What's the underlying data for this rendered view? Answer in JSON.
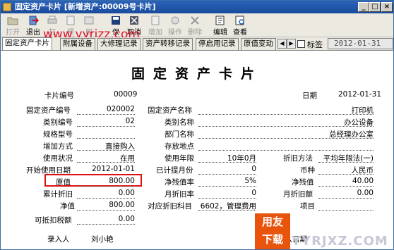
{
  "window": {
    "title": "固定资产卡片 [新增资产:00009号卡片]",
    "min_label": "_",
    "max_label": "□",
    "close_label": "×"
  },
  "watermark": "www.yyrjzz.com",
  "toolbar": [
    {
      "label": "打开",
      "icon": "open-icon",
      "enabled": false
    },
    {
      "label": "退出",
      "icon": "exit-icon",
      "enabled": true
    },
    {
      "label": "打",
      "icon": "print-icon",
      "enabled": false
    },
    {
      "label": "预",
      "icon": "preview-icon",
      "enabled": false
    },
    {
      "label": "刷",
      "icon": "refresh-icon",
      "enabled": false
    },
    {
      "label": "保",
      "icon": "save-icon",
      "enabled": true
    },
    {
      "label": "取消",
      "icon": "cancel-icon",
      "enabled": true
    },
    {
      "label": "增加",
      "icon": "add-icon",
      "enabled": false
    },
    {
      "label": "操作",
      "icon": "operate-icon",
      "enabled": false
    },
    {
      "label": "删除",
      "icon": "delete-icon",
      "enabled": false
    },
    {
      "label": "编辑",
      "icon": "edit-icon",
      "enabled": true
    },
    {
      "label": "查看",
      "icon": "view-icon",
      "enabled": true
    }
  ],
  "tabs": [
    {
      "label": "固定资产卡片",
      "active": true
    },
    {
      "label": "附属设备",
      "active": false
    },
    {
      "label": "大修理记录",
      "active": false
    },
    {
      "label": "资产转移记录",
      "active": false
    },
    {
      "label": "停启用记录",
      "active": false
    },
    {
      "label": "原值变动",
      "active": false
    }
  ],
  "tab_scroll": {
    "left": "◀",
    "right": "▶"
  },
  "tag_checkbox_label": "标签",
  "header_date": "2012-01-31",
  "card": {
    "title": "固定资产卡片",
    "card_no_label": "卡片编号",
    "card_no": "00009",
    "date_label": "日期",
    "date": "2012-01-31",
    "rows": {
      "asset_code_label": "固定资产编号",
      "asset_code": "020002",
      "asset_name_label": "固定资产名称",
      "asset_name": "打印机",
      "category_code_label": "类别编号",
      "category_code": "02",
      "category_name_label": "类别名称",
      "category_name": "办公设备",
      "spec_label": "规格型号",
      "spec": "",
      "dept_label": "部门名称",
      "dept": "总经理办公室",
      "add_method_label": "增加方式",
      "add_method": "直接购入",
      "location_label": "存放地点",
      "location": "",
      "usage_label": "使用状况",
      "usage": "在用",
      "life_label": "使用年限",
      "life": "10年0月",
      "dep_method_label": "折旧方法",
      "dep_method": "平均年限法(一)",
      "start_date_label": "开始使用日期",
      "start_date": "2012-01-01",
      "dep_months_label": "已计提月份",
      "dep_months": "0",
      "currency_label": "币种",
      "currency": "人民币",
      "orig_value_label": "原值",
      "orig_value": "800.00",
      "residual_rate_label": "净残值率",
      "residual_rate": "5%",
      "residual_label": "净残值",
      "residual": "40.00",
      "accum_dep_label": "累计折旧",
      "accum_dep": "0.00",
      "monthly_rate_label": "月折旧率",
      "monthly_rate": "0",
      "monthly_dep_label": "月折旧额",
      "monthly_dep": "0.00",
      "net_value_label": "净值",
      "net_value": "800.00",
      "account_label": "对应折旧科目",
      "account": "6602，管理费用",
      "item_label": "项目",
      "item": "",
      "tax_label": "可抵扣税额",
      "tax": "0.00",
      "recorder_label": "录入人",
      "recorder": "刘小艳",
      "entry_date_label": "录入日期"
    }
  },
  "brand": {
    "logo_top": "用友",
    "logo_bottom": "下载",
    "site": "YYRJXZ.COM"
  },
  "colors": {
    "titlebar": "#1a4b9c",
    "highlight_box": "#dd1111",
    "watermark": "#e0102a",
    "logo_bg": "#e8540c"
  }
}
